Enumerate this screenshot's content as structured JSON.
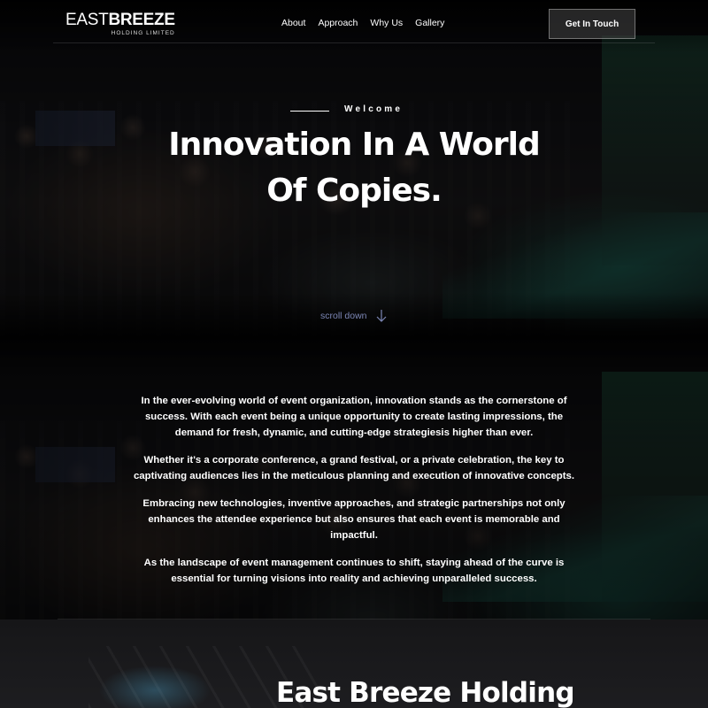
{
  "brand": {
    "name_part1": "EAST",
    "name_part2": "BREEZE",
    "tagline": "HOLDING LIMITED"
  },
  "nav": {
    "items": [
      {
        "label": "About"
      },
      {
        "label": "Approach"
      },
      {
        "label": "Why Us"
      },
      {
        "label": "Gallery"
      }
    ],
    "cta_label": "Get In Touch"
  },
  "hero": {
    "eyebrow": "Welcome",
    "title_line1": "Innovation In A World",
    "title_line2": "Of Copies.",
    "scroll_label": "scroll down",
    "scroll_icon": "arrow-down-icon"
  },
  "intro": {
    "paragraphs": [
      "In the ever-evolving world of event organization, innovation stands as the cornerstone of success. With each event being a unique opportunity to create lasting impressions, the demand for fresh, dynamic, and cutting-edge strategiesis higher than ever.",
      "Whether it's a corporate conference, a grand festival, or a private celebration, the key to captivating audiences lies in the meticulous planning and execution of innovative concepts.",
      "Embracing new technologies, inventive approaches, and strategic partnerships not only enhances the attendee experience but also ensures that each event is memorable and impactful.",
      "As the landscape of event management continues to shift, staying ahead of the curve is essential for turning visions into reality and achieving unparalleled success."
    ]
  },
  "section2": {
    "title": "East Breeze Holding"
  },
  "colors": {
    "background": "#0a0a0c",
    "text": "#ffffff",
    "scroll_accent": "#7c86b5"
  }
}
